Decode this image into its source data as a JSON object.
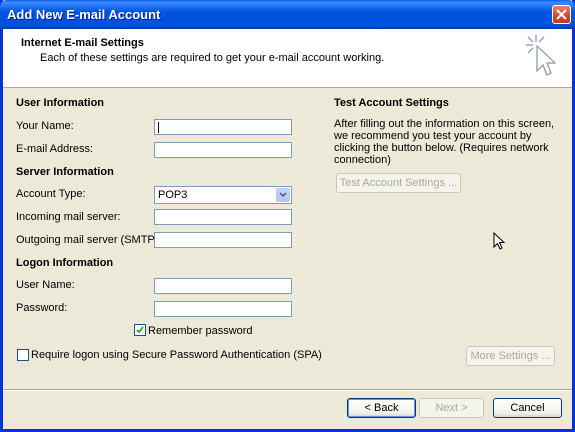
{
  "window": {
    "title": "Add New E-mail Account"
  },
  "header": {
    "title": "Internet E-mail Settings",
    "subtitle": "Each of these settings are required to get your e-mail account working."
  },
  "user_info": {
    "heading": "User Information",
    "name_label": "Your Name:",
    "name_value": "",
    "email_label": "E-mail Address:",
    "email_value": ""
  },
  "server_info": {
    "heading": "Server Information",
    "account_type_label": "Account Type:",
    "account_type_value": "POP3",
    "incoming_label": "Incoming mail server:",
    "incoming_value": "",
    "outgoing_label": "Outgoing mail server (SMTP):",
    "outgoing_value": ""
  },
  "logon_info": {
    "heading": "Logon Information",
    "username_label": "User Name:",
    "username_value": "",
    "password_label": "Password:",
    "password_value": "",
    "remember_label": "Remember password",
    "remember_checked": true,
    "spa_label": "Require logon using Secure Password Authentication (SPA)",
    "spa_checked": false
  },
  "test_settings": {
    "heading": "Test Account Settings",
    "description": "After filling out the information on this screen, we recommend you test your account by clicking the button below. (Requires network connection)",
    "button_label": "Test Account Settings ..."
  },
  "buttons": {
    "more_settings": "More Settings ...",
    "back": "< Back",
    "next": "Next >",
    "cancel": "Cancel"
  }
}
